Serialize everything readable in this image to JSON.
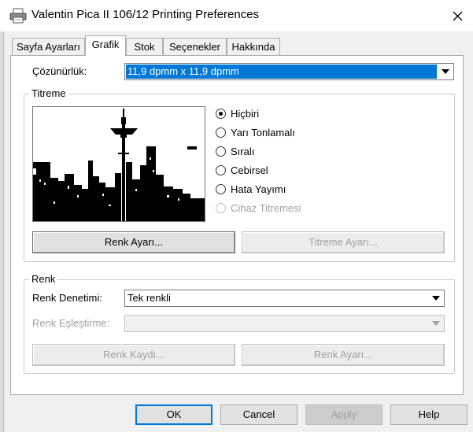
{
  "window": {
    "title": "Valentin Pica II 106/12 Printing Preferences",
    "icon": "printer-icon",
    "close_icon": "close-icon"
  },
  "tabs": [
    {
      "label": "Sayfa Ayarları",
      "active": false
    },
    {
      "label": "Grafik",
      "active": true
    },
    {
      "label": "Stok",
      "active": false
    },
    {
      "label": "Seçenekler",
      "active": false
    },
    {
      "label": "Hakkında",
      "active": false
    }
  ],
  "resolution": {
    "label": "Çözünürlük:",
    "value": "11,9 dpmm x 11,9 dpmm"
  },
  "dither": {
    "group_label": "Titreme",
    "preview_icon": "city-skyline-preview",
    "options": [
      {
        "label": "Hiçbiri",
        "selected": true,
        "enabled": true
      },
      {
        "label": "Yarı Tonlamalı",
        "selected": false,
        "enabled": true
      },
      {
        "label": "Sıralı",
        "selected": false,
        "enabled": true
      },
      {
        "label": "Cebirsel",
        "selected": false,
        "enabled": true
      },
      {
        "label": "Hata Yayımı",
        "selected": false,
        "enabled": true
      },
      {
        "label": "Cihaz Titremesi",
        "selected": false,
        "enabled": false
      }
    ],
    "color_settings_button": "Renk Ayarı...",
    "dither_settings_button": "Titreme Ayarı..."
  },
  "color": {
    "group_label": "Renk",
    "control_label": "Renk Denetimi:",
    "control_value": "Tek renkli",
    "matching_label": "Renk Eşleştirme:",
    "matching_value": "",
    "save_button": "Renk Kaydı...",
    "settings_button": "Renk Ayarı..."
  },
  "footer": {
    "ok": "OK",
    "cancel": "Cancel",
    "apply": "Apply",
    "help": "Help"
  },
  "colors": {
    "selection": "#0078d7",
    "window_bg": "#f0f0f0",
    "disabled_text": "#a0a0a0"
  }
}
